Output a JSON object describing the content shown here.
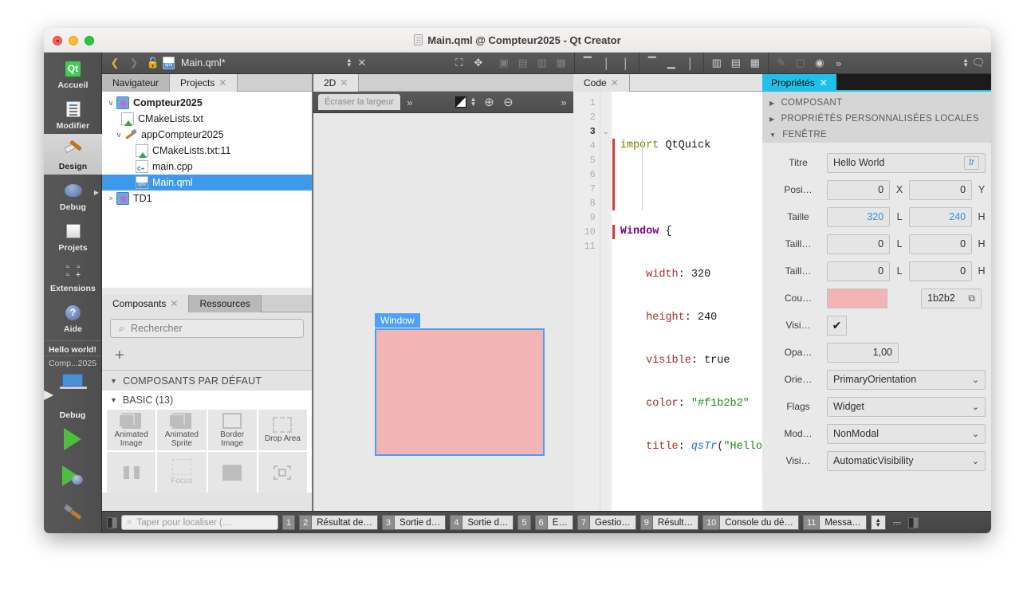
{
  "window": {
    "title": "Main.qml @ Compteur2025 - Qt Creator"
  },
  "modebar": {
    "items": [
      {
        "label": "Accueil",
        "icon": "qt-logo-icon"
      },
      {
        "label": "Modifier",
        "icon": "edit-document-icon"
      },
      {
        "label": "Design",
        "icon": "design-brush-icon"
      },
      {
        "label": "Debug",
        "icon": "debug-bug-icon"
      },
      {
        "label": "Projets",
        "icon": "projects-folder-icon"
      },
      {
        "label": "Extensions",
        "icon": "extensions-grid-icon"
      },
      {
        "label": "Aide",
        "icon": "help-question-icon"
      }
    ],
    "kit": {
      "run_config": "Hello world!",
      "project": "Comp...2025",
      "build_mode": "Debug"
    }
  },
  "toolbar": {
    "filename": "Main.qml*",
    "back_icon": "chevron-left-icon",
    "forward_icon": "chevron-right-icon",
    "lock_icon": "unlock-icon",
    "file_icon": "qml-file-icon",
    "close_icon": "close-icon",
    "split_icon": "split-icon",
    "more_icon": "chevron-double-right-icon",
    "comment_icon": "comment-icon"
  },
  "left_panel": {
    "tabs": [
      {
        "label": "Navigateur",
        "active": false,
        "closable": false
      },
      {
        "label": "Projects",
        "active": true,
        "closable": true
      }
    ],
    "tree": [
      {
        "label": "Compteur2025",
        "indent": 0,
        "twisty": "v",
        "icon": "project-icon",
        "bold": true,
        "selected": false
      },
      {
        "label": "CMakeLists.txt",
        "indent": 1,
        "twisty": "",
        "icon": "cmake-icon",
        "bold": false,
        "selected": false
      },
      {
        "label": "appCompteur2025",
        "indent": 1,
        "twisty": "v",
        "icon": "target-hammer-icon",
        "bold": false,
        "selected": false
      },
      {
        "label": "CMakeLists.txt:11",
        "indent": 2,
        "twisty": "",
        "icon": "cmake-icon",
        "bold": false,
        "selected": false
      },
      {
        "label": "main.cpp",
        "indent": 2,
        "twisty": "",
        "icon": "cpp-file-icon",
        "bold": false,
        "selected": false
      },
      {
        "label": "Main.qml",
        "indent": 2,
        "twisty": "",
        "icon": "qml-file-icon",
        "bold": false,
        "selected": true
      },
      {
        "label": "TD1",
        "indent": 0,
        "twisty": ">",
        "icon": "project-icon",
        "bold": false,
        "selected": false
      }
    ]
  },
  "components_panel": {
    "tabs": [
      {
        "label": "Composants",
        "active": true,
        "closable": true
      },
      {
        "label": "Ressources",
        "active": false,
        "closable": false
      }
    ],
    "search_placeholder": "Rechercher",
    "search_value": "",
    "search_icon": "search-icon",
    "add_icon": "plus-icon",
    "section_title": "COMPOSANTS PAR DÉFAUT",
    "subsection_title": "BASIC (13)",
    "items": [
      {
        "label": "Animated\nImage",
        "icon": "animated-image-icon"
      },
      {
        "label": "Animated\nSprite",
        "icon": "animated-sprite-icon"
      },
      {
        "label": "Border\nImage",
        "icon": "border-image-icon"
      },
      {
        "label": "Drop Area",
        "icon": "drop-area-icon"
      },
      {
        "label": "",
        "icon": "flickable-icon"
      },
      {
        "label": "Focus",
        "icon": "focus-scope-icon"
      },
      {
        "label": "",
        "icon": "image-icon"
      },
      {
        "label": "",
        "icon": "item-icon"
      }
    ]
  },
  "design_view": {
    "tabs": [
      {
        "label": "2D",
        "active": true,
        "closable": true
      }
    ],
    "width_chip": "Écraser la largeur",
    "more_icon": "chevron-double-right-icon",
    "checker_icon": "background-checker-icon",
    "zoom_in_icon": "zoom-in-icon",
    "zoom_out_icon": "zoom-out-icon",
    "artboard": {
      "label": "Window",
      "fill_color": "#f2b4b4",
      "border_color": "#4e9ef0"
    }
  },
  "code_editor": {
    "tabs": [
      {
        "label": "Code",
        "active": true,
        "closable": true
      }
    ],
    "line_numbers": [
      "1",
      "2",
      "3",
      "4",
      "5",
      "6",
      "7",
      "8",
      "9",
      "10",
      "11"
    ],
    "current_line": "3",
    "lines": [
      [
        {
          "t": "import",
          "c": "k-import"
        },
        {
          "t": " QtQuick",
          "c": "k-plain"
        }
      ],
      [],
      [
        {
          "t": "Window",
          "c": "k-type"
        },
        {
          "t": " {",
          "c": "k-plain"
        }
      ],
      [
        {
          "t": "    width",
          "c": "k-prop"
        },
        {
          "t": ": ",
          "c": "k-plain"
        },
        {
          "t": "320",
          "c": "k-num"
        }
      ],
      [
        {
          "t": "    height",
          "c": "k-prop"
        },
        {
          "t": ": ",
          "c": "k-plain"
        },
        {
          "t": "240",
          "c": "k-num"
        }
      ],
      [
        {
          "t": "    visible",
          "c": "k-prop"
        },
        {
          "t": ": ",
          "c": "k-plain"
        },
        {
          "t": "true",
          "c": "k-bool"
        }
      ],
      [
        {
          "t": "    color",
          "c": "k-prop"
        },
        {
          "t": ": ",
          "c": "k-plain"
        },
        {
          "t": "\"#f1b2b2\"",
          "c": "k-str"
        }
      ],
      [
        {
          "t": "    title",
          "c": "k-prop"
        },
        {
          "t": ": ",
          "c": "k-plain"
        },
        {
          "t": "qsTr",
          "c": "k-fn"
        },
        {
          "t": "(",
          "c": "k-plain"
        },
        {
          "t": "\"Hello",
          "c": "k-str"
        }
      ],
      [],
      [
        {
          "t": "}",
          "c": "k-plain"
        }
      ],
      []
    ]
  },
  "properties_panel": {
    "tabs": [
      {
        "label": "Propriétés",
        "active": true,
        "closable": true
      }
    ],
    "sections": [
      {
        "label": "COMPOSANT",
        "open": false
      },
      {
        "label": "PROPRIÉTÉS PERSONNALISÉES LOCALES",
        "open": false
      },
      {
        "label": "FENÊTRE",
        "open": true
      }
    ],
    "rows": [
      {
        "name": "titre",
        "label": "Titre",
        "kind": "text",
        "value": "Hello World",
        "badge": "tr"
      },
      {
        "name": "position",
        "label": "Posi…",
        "kind": "pair",
        "v1": "0",
        "u1": "X",
        "v2": "0",
        "u2": "Y",
        "blue1": false,
        "blue2": false
      },
      {
        "name": "taille",
        "label": "Taille",
        "kind": "pair",
        "v1": "320",
        "u1": "L",
        "v2": "240",
        "u2": "H",
        "blue1": true,
        "blue2": true
      },
      {
        "name": "taille-min",
        "label": "Taill…",
        "kind": "pair",
        "v1": "0",
        "u1": "L",
        "v2": "0",
        "u2": "H",
        "blue1": false,
        "blue2": false
      },
      {
        "name": "taille-max",
        "label": "Taill…",
        "kind": "pair",
        "v1": "0",
        "u1": "L",
        "v2": "0",
        "u2": "H",
        "blue1": false,
        "blue2": false
      },
      {
        "name": "couleur",
        "label": "Cou…",
        "kind": "color",
        "swatch": "#f2b4b4",
        "hex": "1b2b2"
      },
      {
        "name": "visible",
        "label": "Visi…",
        "kind": "check",
        "checked": true
      },
      {
        "name": "opacite",
        "label": "Opa…",
        "kind": "num",
        "value": "1,00"
      },
      {
        "name": "orientation",
        "label": "Orie…",
        "kind": "select",
        "value": "PrimaryOrientation"
      },
      {
        "name": "flags",
        "label": "Flags",
        "kind": "select",
        "value": "Widget"
      },
      {
        "name": "modalite",
        "label": "Mod…",
        "kind": "select",
        "value": "NonModal"
      },
      {
        "name": "visibilite",
        "label": "Visi…",
        "kind": "select",
        "value": "AutomaticVisibility"
      }
    ]
  },
  "statusbar": {
    "sidebar_toggle_icon": "sidebar-toggle-icon",
    "locate_placeholder": "Taper pour localiser (…",
    "locate_value": "",
    "outputs": [
      {
        "num": "1",
        "label": ""
      },
      {
        "num": "2",
        "label": "Résultat de…"
      },
      {
        "num": "3",
        "label": "Sortie d…"
      },
      {
        "num": "4",
        "label": "Sortie d…"
      },
      {
        "num": "5",
        "label": ""
      },
      {
        "num": "6",
        "label": "E…"
      },
      {
        "num": "7",
        "label": "Gestio…"
      },
      {
        "num": "9",
        "label": "Résult…"
      },
      {
        "num": "10",
        "label": "Console du dé…"
      },
      {
        "num": "11",
        "label": "Messa…"
      }
    ],
    "right_icons": [
      "spinner-stepper-icon",
      "progress-details-icon",
      "right-sidebar-toggle-icon"
    ]
  },
  "colors": {
    "accent": "#21c0e8",
    "selection": "#3d9ae8",
    "artboard_fill": "#f2b4b4",
    "artboard_border": "#4e9ef0"
  }
}
